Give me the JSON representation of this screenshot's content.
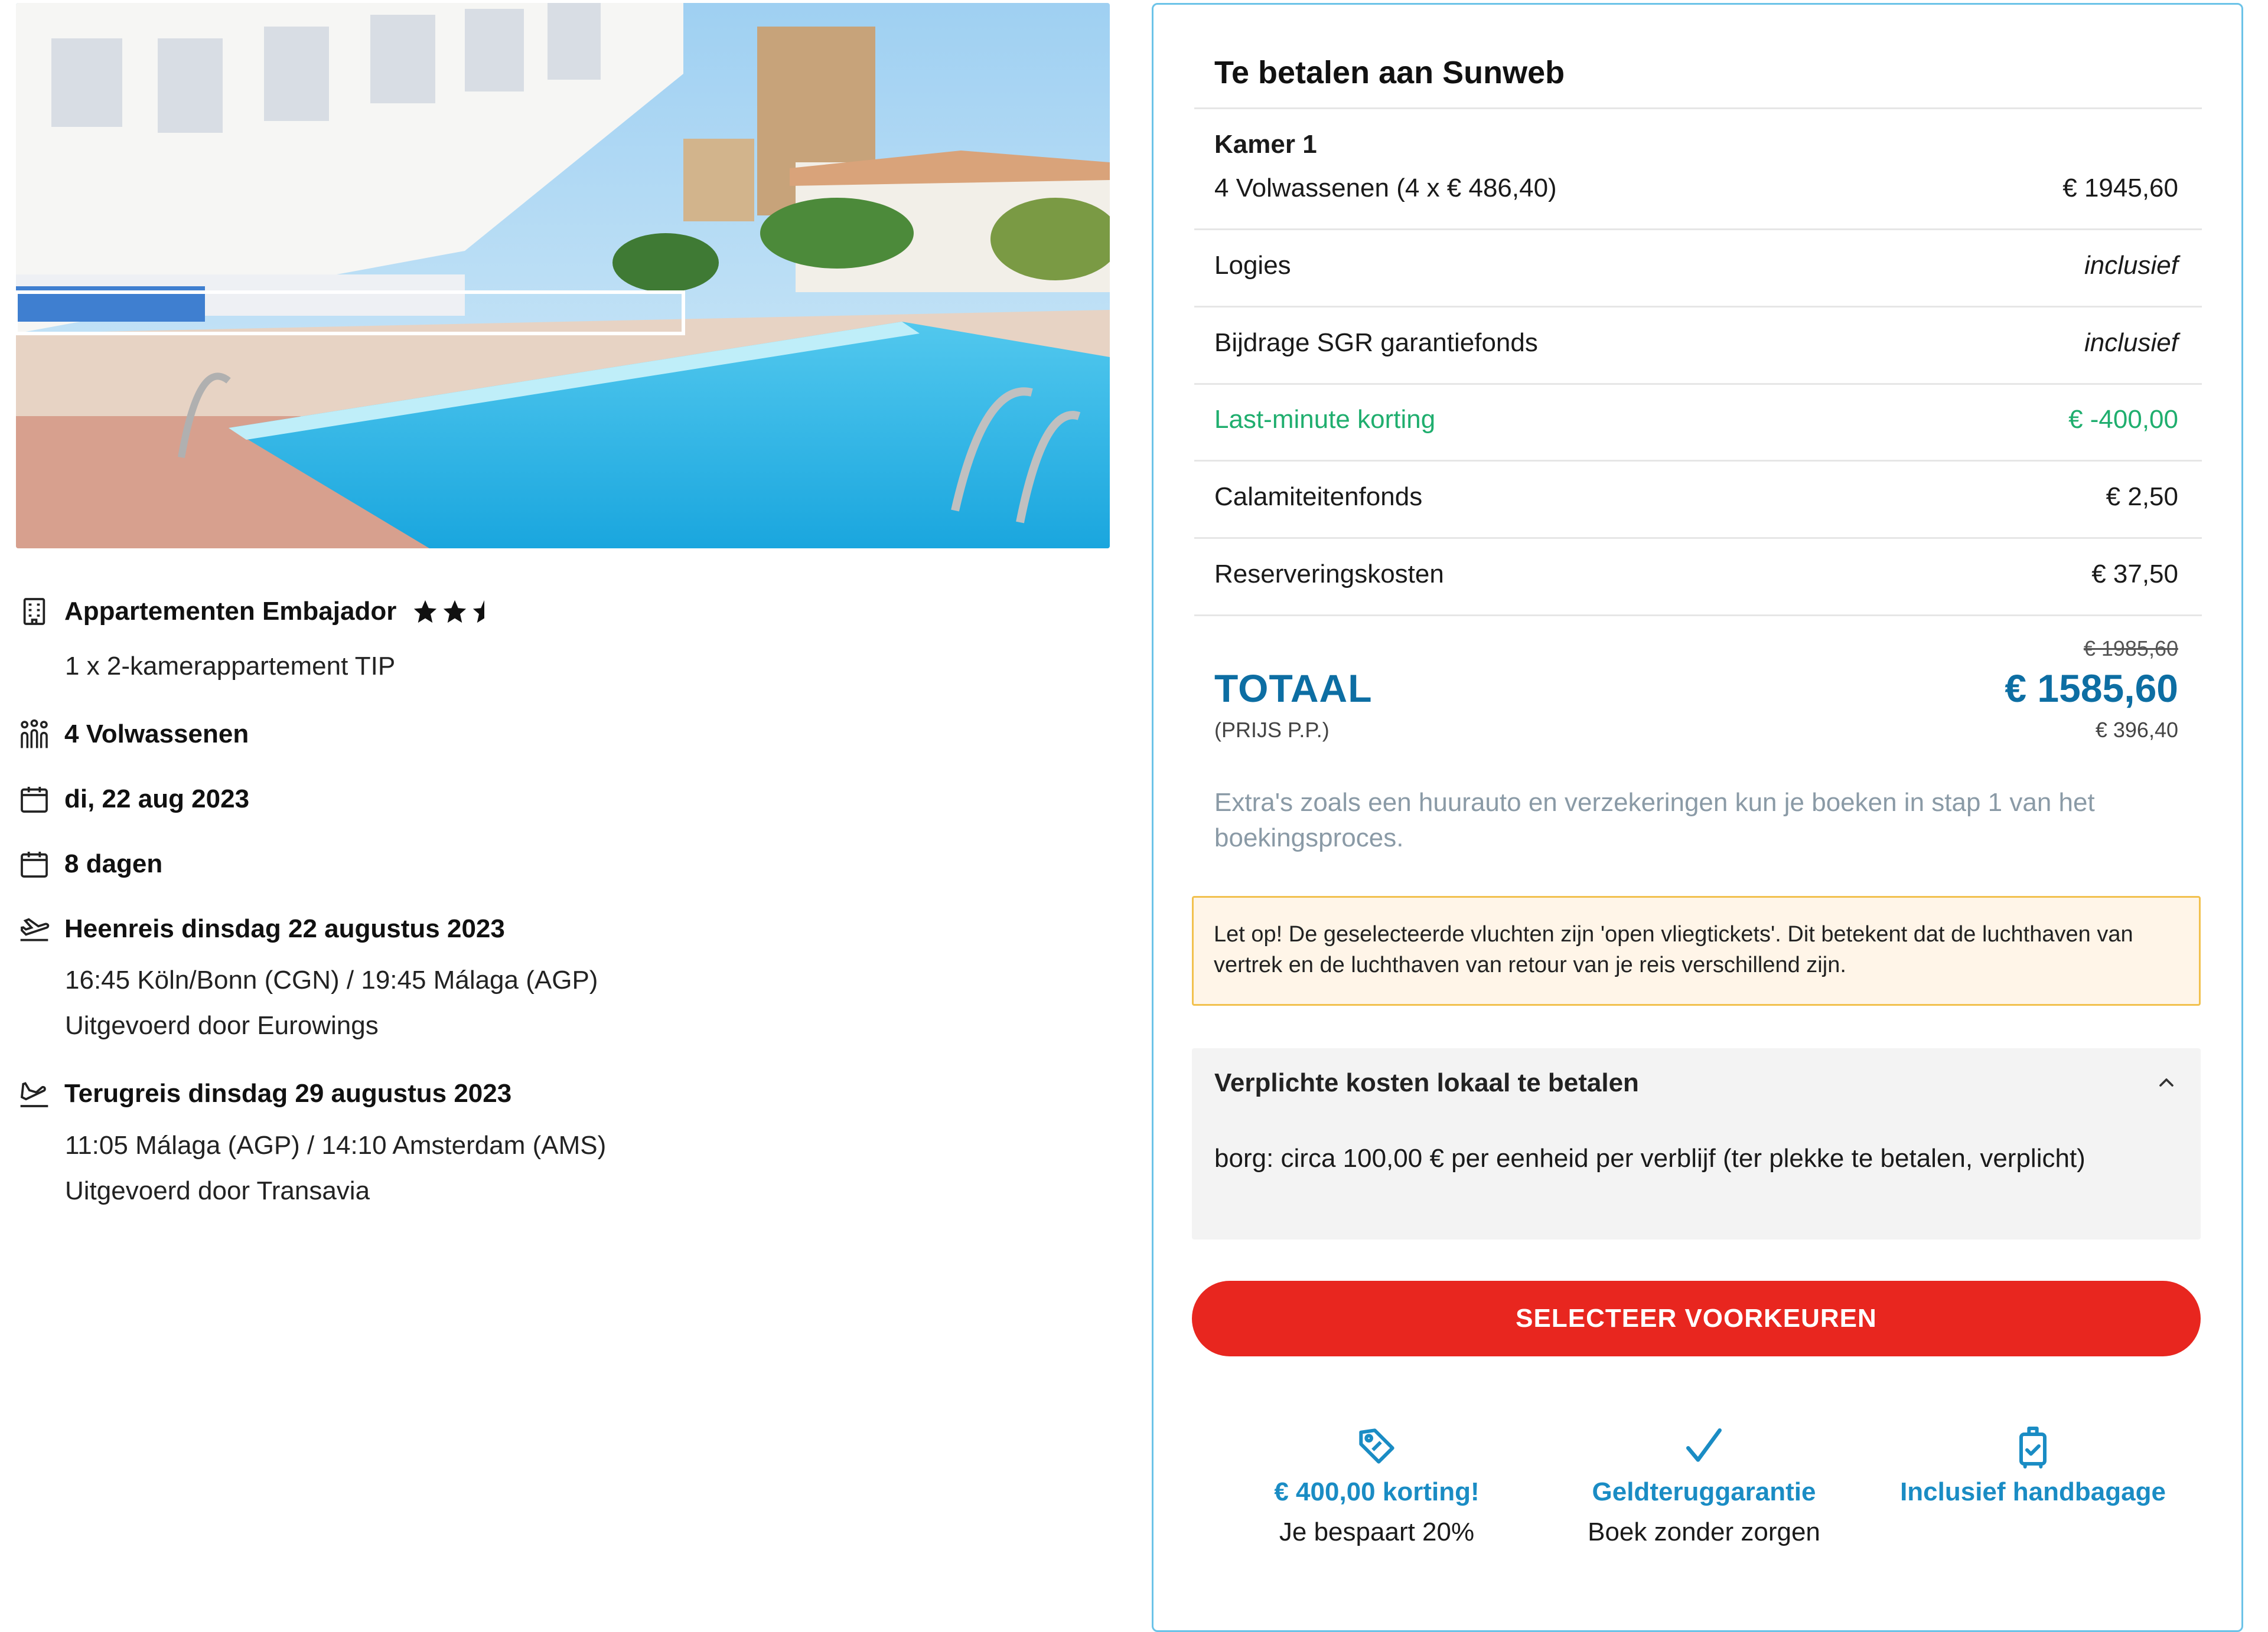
{
  "hotel": {
    "name": "Appartementen Embajador",
    "room": "1 x 2-kamerappartement TIP",
    "rating_stars": 2.5,
    "photo_description_icon": "hotel-pool-photo"
  },
  "travelers": "4 Volwassenen",
  "date": "di, 22 aug 2023",
  "duration": "8 dagen",
  "outbound": {
    "title": "Heenreis dinsdag 22 augustus 2023",
    "times": "16:45 Köln/Bonn (CGN) / 19:45 Málaga (AGP)",
    "operator": "Uitgevoerd door Eurowings"
  },
  "return": {
    "title": "Terugreis dinsdag 29 augustus 2023",
    "times": "11:05 Málaga (AGP) / 14:10 Amsterdam (AMS)",
    "operator": "Uitgevoerd door Transavia"
  },
  "summary": {
    "title": "Te betalen aan Sunweb",
    "room_heading": "Kamer 1",
    "rows": [
      {
        "label": "4 Volwassenen (4 x € 486,40)",
        "value": "€ 1945,60"
      },
      {
        "label": "Logies",
        "value": "inclusief"
      },
      {
        "label": "Bijdrage SGR garantiefonds",
        "value": "inclusief"
      },
      {
        "label": "Last-minute korting",
        "value": "€ -400,00"
      },
      {
        "label": "Calamiteitenfonds",
        "value": "€ 2,50"
      },
      {
        "label": "Reserveringskosten",
        "value": "€ 37,50"
      }
    ],
    "total_label": "TOTAAL",
    "total_sub": "(PRIJS P.P.)",
    "old_price": "€ 1985,60",
    "total_price": "€ 1585,60",
    "per_person": "€ 396,40",
    "extras_note": "Extra's zoals een huurauto en verzekeringen kun je boeken in stap 1 van het boekingsproces.",
    "warning": "Let op! De geselecteerde vluchten zijn 'open vliegtickets'. Dit betekent dat de luchthaven van vertrek en de luchthaven van retour van je reis verschillend zijn.",
    "local_costs_title": "Verplichte kosten lokaal te betalen",
    "local_costs_text": "borg: circa 100,00 € per eenheid per verblijf (ter plekke te betalen, verplicht)",
    "cta_label": "SELECTEER VOORKEUREN"
  },
  "usps": [
    {
      "icon": "discount-tag-icon",
      "title": "€ 400,00 korting!",
      "sub": "Je bespaart 20%"
    },
    {
      "icon": "checkmark-icon",
      "title": "Geldteruggarantie",
      "sub": "Boek zonder zorgen"
    },
    {
      "icon": "luggage-check-icon",
      "title": "Inclusief handbagage",
      "sub": ""
    }
  ],
  "colors": {
    "accent_blue": "#0d6ea3",
    "usp_blue": "#1a8cc4",
    "discount_green": "#1fae6e",
    "cta_red": "#e8261f",
    "warning_bg": "#fff5e8",
    "warning_border": "#f2c14e",
    "panel_border": "#6cc3e8"
  }
}
